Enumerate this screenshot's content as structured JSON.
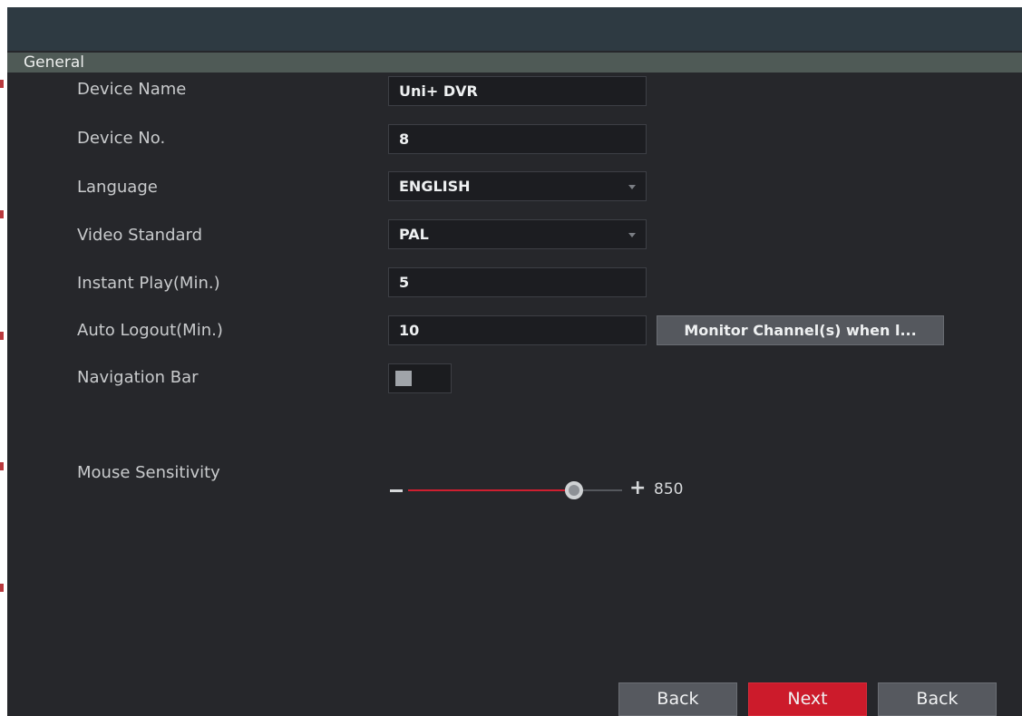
{
  "section": {
    "title": "General"
  },
  "fields": {
    "device_name": {
      "label": "Device Name",
      "value": "Uni+ DVR"
    },
    "device_no": {
      "label": "Device No.",
      "value": "8"
    },
    "language": {
      "label": "Language",
      "value": "ENGLISH"
    },
    "video_standard": {
      "label": "Video Standard",
      "value": "PAL"
    },
    "instant_play": {
      "label": "Instant Play(Min.)",
      "value": "5"
    },
    "auto_logout": {
      "label": "Auto Logout(Min.)",
      "value": "10"
    },
    "monitor_button": {
      "label": "Monitor Channel(s) when l..."
    },
    "navigation_bar": {
      "label": "Navigation Bar",
      "enabled": false
    },
    "mouse_sensitivity": {
      "label": "Mouse Sensitivity",
      "minus": "−",
      "plus": "+",
      "value": "850",
      "level_fraction": 0.8
    }
  },
  "footer": {
    "back_label": "Back",
    "next_label": "Next",
    "back2_label": "Back"
  },
  "colors": {
    "accent": "#cc1b2b",
    "background": "#26272b",
    "header": "#4f5a56"
  },
  "icons": {
    "dropdown": "caret-down-icon"
  }
}
